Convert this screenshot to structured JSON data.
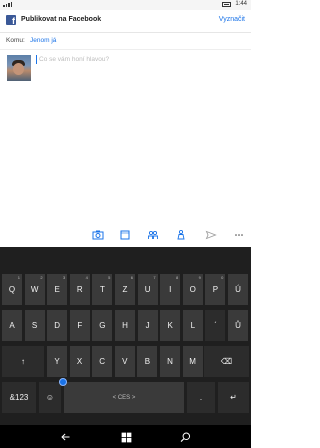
{
  "status_bar": {
    "time": "1:44"
  },
  "header": {
    "title": "Publikovat na Facebook",
    "publish_label": "Vyznačit"
  },
  "audience": {
    "label": "Komu:",
    "value": "Jenom já"
  },
  "composer": {
    "placeholder": "Co se vám honí hlavou?"
  },
  "toolbar_icons": [
    "camera-icon",
    "frame-icon",
    "people-icon",
    "location-icon",
    "send-icon",
    "more-icon"
  ],
  "keyboard": {
    "row1": [
      {
        "main": "Q",
        "hint": "1"
      },
      {
        "main": "W",
        "hint": "2"
      },
      {
        "main": "E",
        "hint": "3"
      },
      {
        "main": "R",
        "hint": "4"
      },
      {
        "main": "T",
        "hint": "5"
      },
      {
        "main": "Z",
        "hint": "6"
      },
      {
        "main": "U",
        "hint": "7"
      },
      {
        "main": "I",
        "hint": "8"
      },
      {
        "main": "O",
        "hint": "9"
      },
      {
        "main": "P",
        "hint": "0"
      },
      {
        "main": "Ú",
        "hint": ""
      }
    ],
    "row2": [
      "A",
      "S",
      "D",
      "F",
      "G",
      "H",
      "J",
      "K",
      "L",
      "ˊ",
      "Ů"
    ],
    "row3": [
      "↑",
      "Y",
      "X",
      "C",
      "V",
      "B",
      "N",
      "M",
      "⌫"
    ],
    "row4": {
      "symbols": "&123",
      "emoji": "☺",
      "space": "< CES >",
      "period": ".",
      "enter": "↵"
    }
  },
  "colors": {
    "facebook": "#3b5998",
    "accent": "#1a73e8",
    "keyboard_bg": "#1f1f1f",
    "key_bg": "#3a3a3a"
  }
}
